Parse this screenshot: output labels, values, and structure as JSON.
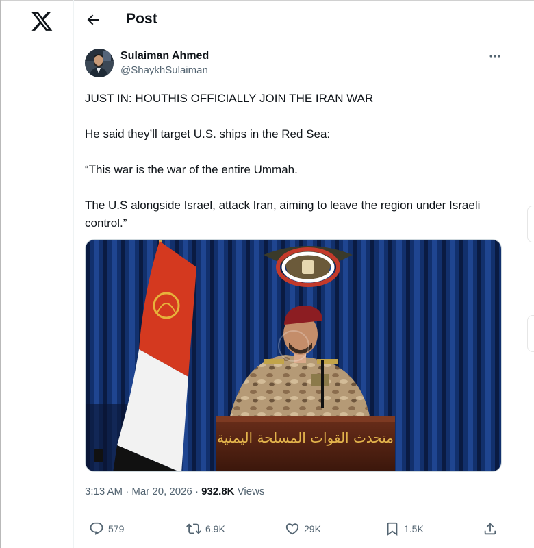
{
  "header": {
    "title": "Post"
  },
  "author": {
    "display_name": "Sulaiman Ahmed",
    "handle": "@ShaykhSulaiman"
  },
  "tweet": {
    "paragraphs": [
      "JUST IN: HOUTHIS OFFICIALLY JOIN THE IRAN WAR",
      "He said they’ll target U.S. ships in the Red Sea:",
      "“This war is the war of the entire Ummah.",
      "The U.S alongside Israel, attack Iran, aiming to leave the region under Israeli control.”"
    ],
    "media": {
      "podium_text": "متحدث القوات المسلحة اليمنية"
    }
  },
  "meta": {
    "time": "3:13 AM",
    "separator": "·",
    "date": "Mar 20, 2026",
    "views_count": "932.8K",
    "views_label": "Views"
  },
  "actions": {
    "replies": "579",
    "reposts": "6.9K",
    "likes": "29K",
    "bookmarks": "1.5K"
  },
  "icons": {
    "logo": "x-logo-icon",
    "back": "arrow-left-icon",
    "more": "more-horizontal-icon",
    "reply": "reply-icon",
    "repost": "repost-icon",
    "like": "heart-icon",
    "bookmark": "bookmark-icon",
    "share": "share-icon"
  },
  "colors": {
    "text_primary": "#0f1419",
    "text_secondary": "#536471",
    "divider": "#eff3f4"
  }
}
